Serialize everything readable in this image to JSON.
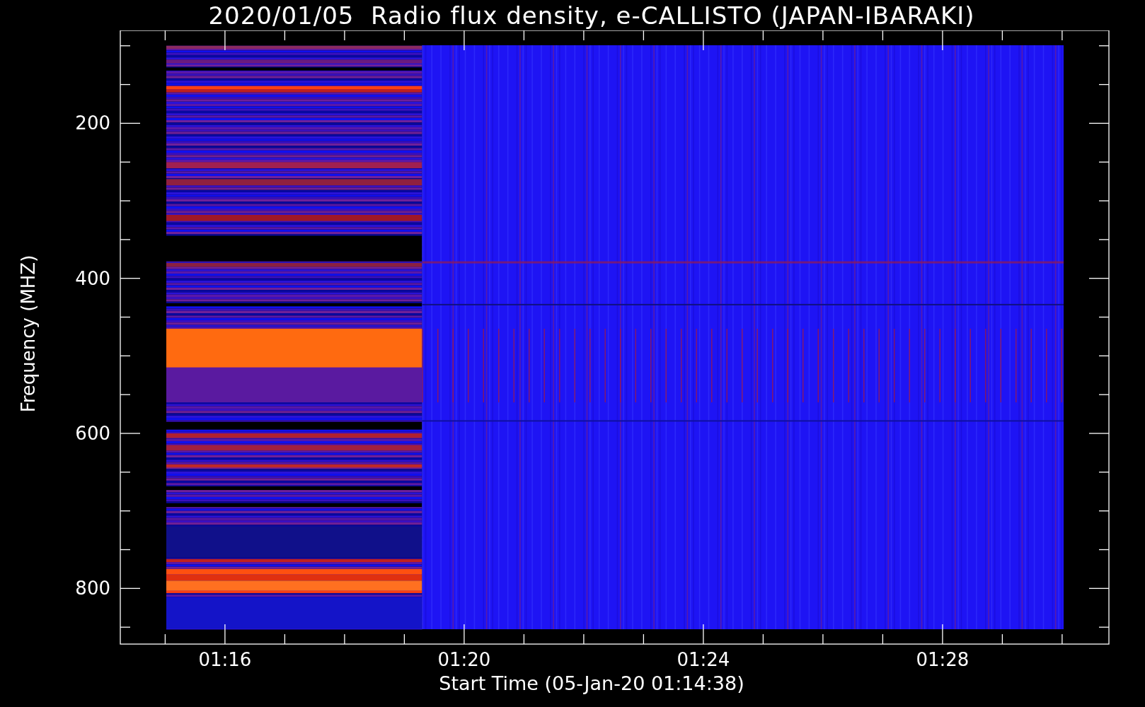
{
  "title": "2020/01/05  Radio flux density, e-CALLISTO (JAPAN-IBARAKI)",
  "y_axis": {
    "label": "Frequency (MHZ)",
    "ticks": [
      "200",
      "400",
      "600",
      "800"
    ]
  },
  "x_axis": {
    "label": "Start Time (05-Jan-20 01:14:38)",
    "ticks": [
      "01:16",
      "01:20",
      "01:24",
      "01:28"
    ]
  }
}
